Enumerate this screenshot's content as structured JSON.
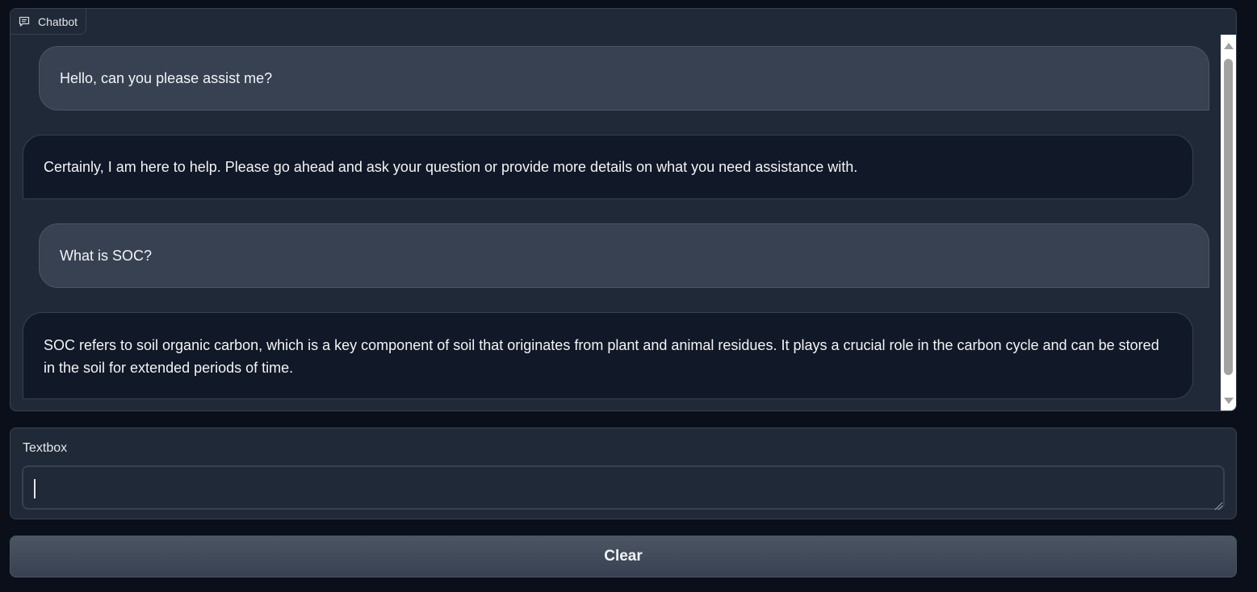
{
  "chatbot": {
    "label": "Chatbot",
    "label_icon": "chat-icon",
    "messages": [
      {
        "role": "user",
        "text": "Hello, can you please assist me?"
      },
      {
        "role": "bot",
        "text": "Certainly, I am here to help. Please go ahead and ask your question or provide more details on what you need assistance with."
      },
      {
        "role": "user",
        "text": "What is SOC?"
      },
      {
        "role": "bot",
        "text": "SOC refers to soil organic carbon, which is a key component of soil that originates from plant and animal residues. It plays a crucial role in the carbon cycle and can be stored in the soil for extended periods of time."
      }
    ]
  },
  "textbox": {
    "label": "Textbox",
    "value": "",
    "placeholder": ""
  },
  "clear_button": {
    "label": "Clear"
  },
  "colors": {
    "background": "#0b0f19",
    "panel": "#1f2937",
    "user_bubble": "#374151",
    "bot_bubble": "#111827",
    "button": "#4b5563"
  }
}
